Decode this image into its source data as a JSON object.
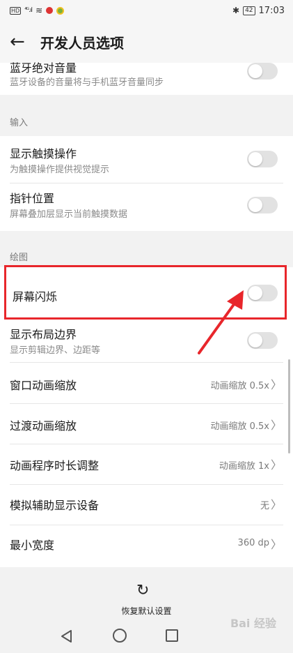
{
  "status_bar": {
    "hd": "HD",
    "signal": "⁴ᴳ.ıl",
    "wifi": "≋",
    "battery": "42",
    "time": "17:03"
  },
  "app_bar": {
    "title": "开发人员选项"
  },
  "bluetooth_volume": {
    "title": "蓝牙绝对音量",
    "subtitle": "蓝牙设备的音量将与手机蓝牙音量同步"
  },
  "input_section": {
    "label": "输入",
    "items": [
      {
        "title": "显示触摸操作",
        "subtitle": "为触摸操作提供视觉提示"
      },
      {
        "title": "指针位置",
        "subtitle": "屏幕叠加层显示当前触摸数据"
      }
    ]
  },
  "drawing_section": {
    "label": "绘图",
    "screen_flash": {
      "title": "屏幕闪烁"
    },
    "layout_bounds": {
      "title": "显示布局边界",
      "subtitle": "显示剪辑边界、边距等"
    },
    "nav_items": [
      {
        "title": "窗口动画缩放",
        "value": "动画缩放 0.5x"
      },
      {
        "title": "过渡动画缩放",
        "value": "动画缩放 0.5x"
      },
      {
        "title": "动画程序时长调整",
        "value": "动画缩放 1x"
      },
      {
        "title": "模拟辅助显示设备",
        "value": "无"
      },
      {
        "title": "最小宽度",
        "value": "360 dp"
      }
    ]
  },
  "bottom": {
    "reset_label": "恢复默认设置"
  },
  "watermark": "Bai 经验",
  "icons": {
    "back": "back-arrow-icon",
    "chevron": "chevron-right-icon",
    "reset": "reset-icon"
  },
  "colors": {
    "highlight": "#e8262b",
    "toggle_off": "#e2e2e2"
  }
}
